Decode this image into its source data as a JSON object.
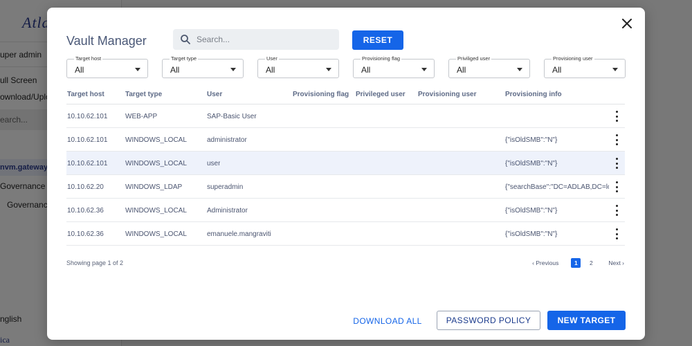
{
  "background": {
    "logo": "Atla",
    "items": [
      "uper admin",
      "ull Screen",
      "ownload/Uplo",
      "earch...",
      "nvm.gateway.it",
      "Governance",
      "Governance",
      "nglish",
      "ica"
    ]
  },
  "modal": {
    "title": "Vault Manager",
    "search_placeholder": "Search...",
    "reset_label": "RESET",
    "close_icon": "close-icon"
  },
  "filters": [
    {
      "label": "Target host",
      "value": "All"
    },
    {
      "label": "Target type",
      "value": "All"
    },
    {
      "label": "User",
      "value": "All"
    },
    {
      "label": "Provisioning flag",
      "value": "All"
    },
    {
      "label": "Priviliged user",
      "value": "All"
    },
    {
      "label": "Provisioning user",
      "value": "All"
    }
  ],
  "table": {
    "headers": [
      "Target host",
      "Target type",
      "User",
      "Provisioning flag",
      "Privileged user",
      "Provisioning user",
      "Provisioning info"
    ],
    "rows": [
      {
        "host": "10.10.62.101",
        "type": "WEB-APP",
        "user": "SAP-Basic User",
        "flag": "",
        "priv": "",
        "puser": "",
        "info": ""
      },
      {
        "host": "10.10.62.101",
        "type": "WINDOWS_LOCAL",
        "user": "administrator",
        "flag": "",
        "priv": "",
        "puser": "",
        "info": "{\"isOldSMB\":\"N\"}"
      },
      {
        "host": "10.10.62.101",
        "type": "WINDOWS_LOCAL",
        "user": "user",
        "flag": "",
        "priv": "",
        "puser": "",
        "info": "{\"isOldSMB\":\"N\"}"
      },
      {
        "host": "10.10.62.20",
        "type": "WINDOWS_LDAP",
        "user": "superadmin",
        "flag": "",
        "priv": "",
        "puser": "",
        "info": "{\"searchBase\":\"DC=ADLAB,DC=lo..."
      },
      {
        "host": "10.10.62.36",
        "type": "WINDOWS_LOCAL",
        "user": "Administrator",
        "flag": "",
        "priv": "",
        "puser": "",
        "info": "{\"isOldSMB\":\"N\"}"
      },
      {
        "host": "10.10.62.36",
        "type": "WINDOWS_LOCAL",
        "user": "emanuele.mangraviti",
        "flag": "",
        "priv": "",
        "puser": "",
        "info": "{\"isOldSMB\":\"N\"}"
      }
    ],
    "selected_row": 2
  },
  "pagination": {
    "showing": "Showing page 1 of 2",
    "prev": "‹ Previous",
    "pages": [
      "1",
      "2"
    ],
    "current": "1",
    "next": "Next ›"
  },
  "footer": {
    "download_all": "DOWNLOAD ALL",
    "password_policy": "PASSWORD POLICY",
    "new_target": "NEW TARGET"
  },
  "colors": {
    "primary": "#1565e8",
    "title": "#4a5877",
    "selected_row": "#eef2fb"
  }
}
